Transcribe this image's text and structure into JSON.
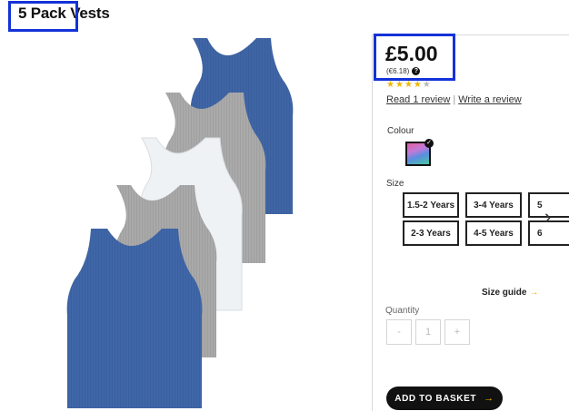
{
  "product": {
    "title": "5 Pack Vests",
    "price": "£5.00",
    "price_alt": "(€6.18)",
    "rating": {
      "value": 4,
      "max": 5
    },
    "review_link": "Read 1 review",
    "review_sep": "|",
    "write_review": "Write a review"
  },
  "colour": {
    "label": "Colour",
    "selected": "multi",
    "swatch_colors": [
      "#e05fa0",
      "#c27ad8",
      "#5a8de0",
      "#48c8a0"
    ]
  },
  "size": {
    "label": "Size",
    "options_row1": [
      "1.5-2 Years",
      "3-4 Years",
      "5"
    ],
    "options_row2": [
      "2-3 Years",
      "4-5 Years",
      "6"
    ]
  },
  "size_guide": "Size guide",
  "quantity": {
    "label": "Quantity",
    "minus": "-",
    "value": "1",
    "plus": "+"
  },
  "basket_button": "ADD TO BASKET",
  "icons": {
    "help": "question-circle-icon",
    "check": "check-badge-icon",
    "next": "chevron-right-icon",
    "arrow": "arrow-right-icon"
  },
  "colors": {
    "highlight": "#1432d8",
    "star": "#f2b500",
    "vest_blue": "#3f65a6",
    "vest_grey": "#a9a9a9",
    "vest_white": "#eef2f4"
  }
}
